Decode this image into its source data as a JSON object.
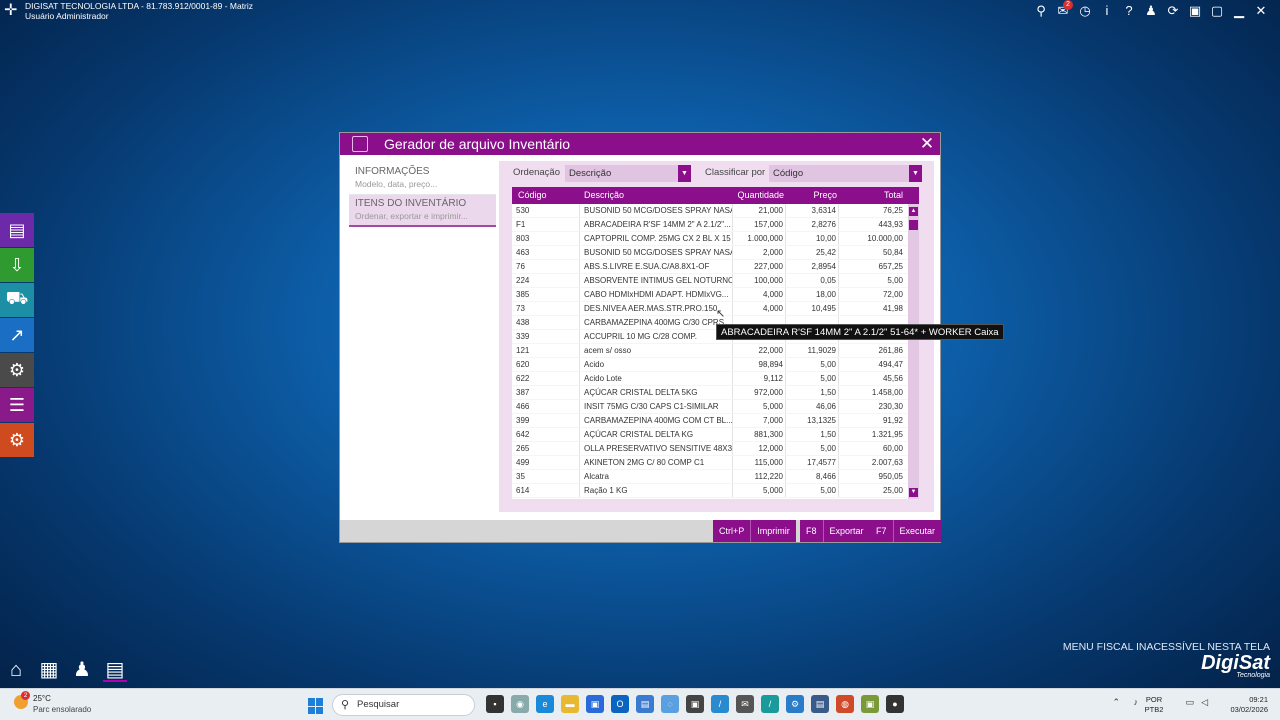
{
  "topbar": {
    "company": "DIGISAT TECNOLOGIA LTDA - 81.783.912/0001-89 - Matriz",
    "user": "Usuário Administrador",
    "notification_count": "2",
    "icons": [
      "search-icon",
      "bell-icon",
      "clock-icon",
      "info-icon",
      "help-icon",
      "users-icon",
      "sync-icon",
      "lock-icon",
      "lock-icon",
      "minimize-icon",
      "close-icon"
    ]
  },
  "sidebar": {
    "items": [
      {
        "icon": "document-icon",
        "color": "#6d2aa8"
      },
      {
        "icon": "download-cart-icon",
        "color": "#2f9a2f"
      },
      {
        "icon": "cart-icon",
        "color": "#1c8fa5"
      },
      {
        "icon": "chart-icon",
        "color": "#1a6fc4"
      },
      {
        "icon": "settings-icon",
        "color": "#4a4a4a"
      },
      {
        "icon": "report-icon",
        "color": "#8a1a8a"
      },
      {
        "icon": "doc-settings-icon",
        "color": "#d04a1f"
      }
    ]
  },
  "dialog": {
    "title": "Gerador de arquivo Inventário",
    "nav": [
      {
        "title": "INFORMAÇÕES",
        "subtitle": "Modelo, data, preço..."
      },
      {
        "title": "ITENS DO INVENTÁRIO",
        "subtitle": "Ordenar, exportar e imprimir..."
      }
    ],
    "ordenacao_label": "Ordenação",
    "ordenacao_value": "Descrição",
    "classificar_label": "Classificar por",
    "classificar_value": "Código",
    "columns": [
      "Código",
      "Descrição",
      "Quantidade",
      "Preço",
      "Total"
    ],
    "rows": [
      [
        "530",
        "BUSONID 50 MCG/DOSES SPRAY NASA...",
        "21,000",
        "3,6314",
        "76,25"
      ],
      [
        "F1",
        "ABRACADEIRA R'SF 14MM 2\" A 2.1/2\"...",
        "157,000",
        "2,8276",
        "443,93"
      ],
      [
        "803",
        "CAPTOPRIL COMP. 25MG CX 2 BL X 15",
        "1.000,000",
        "10,00",
        "10.000,00"
      ],
      [
        "463",
        "BUSONID 50 MCG/DOSES SPRAY NASA...",
        "2,000",
        "25,42",
        "50,84"
      ],
      [
        "76",
        "ABS.S.LIVRE E.SUA.C/A8.8X1-OF",
        "227,000",
        "2,8954",
        "657,25"
      ],
      [
        "224",
        "ABSORVENTE INTIMUS GEL NOTURNO...",
        "100,000",
        "0,05",
        "5,00"
      ],
      [
        "385",
        "CABO HDMIxHDMI  ADAPT. HDMIxVG...",
        "4,000",
        "18,00",
        "72,00"
      ],
      [
        "73",
        "DES.NIVEA AER.MAS.STR.PRO.150",
        "4,000",
        "10,495",
        "41,98"
      ],
      [
        "438",
        "CARBAMAZEPINA 400MG C/30 CPRS",
        "",
        "",
        ""
      ],
      [
        "339",
        "ACCUPRIL 10 MG C/28 COMP.",
        "",
        "",
        ""
      ],
      [
        "121",
        "acem s/ osso",
        "22,000",
        "11,9029",
        "261,86"
      ],
      [
        "620",
        "Acido",
        "98,894",
        "5,00",
        "494,47"
      ],
      [
        "622",
        "Acido Lote",
        "9,112",
        "5,00",
        "45,56"
      ],
      [
        "387",
        "AÇÚCAR CRISTAL DELTA 5KG",
        "972,000",
        "1,50",
        "1.458,00"
      ],
      [
        "466",
        "INSIT 75MG C/30 CAPS C1-SIMILAR",
        "5,000",
        "46,06",
        "230,30"
      ],
      [
        "399",
        "CARBAMAZEPINA 400MG COM CT BL...",
        "7,000",
        "13,1325",
        "91,92"
      ],
      [
        "642",
        "AÇÚCAR CRISTAL DELTA KG",
        "881,300",
        "1,50",
        "1.321,95"
      ],
      [
        "265",
        "OLLA PRESERVATIVO SENSITIVE 48X3U...",
        "12,000",
        "5,00",
        "60,00"
      ],
      [
        "499",
        "AKINETON 2MG C/ 80 COMP C1",
        "115,000",
        "17,4577",
        "2.007,63"
      ],
      [
        "35",
        "Alcatra",
        "112,220",
        "8,466",
        "950,05"
      ],
      [
        "614",
        "Ração 1 KG",
        "5,000",
        "5,00",
        "25,00"
      ]
    ],
    "tooltip": "ABRACADEIRA R'SF 14MM 2\" A 2.1/2\" 51-64* + WORKER Caixa",
    "buttons": [
      {
        "key": "Ctrl+P",
        "label": "Imprimir"
      },
      {
        "key": "F8",
        "label": "Exportar"
      },
      {
        "key": "F7",
        "label": "Executar"
      }
    ]
  },
  "fiscal_notice": "MENU FISCAL INACESSÍVEL NESTA TELA",
  "brand": {
    "name": "DigiSat",
    "sub": "Tecnologia"
  },
  "taskbar": {
    "weather_temp": "25°C",
    "weather_desc": "Parc ensolarado",
    "weather_badge": "2",
    "search_placeholder": "Pesquisar",
    "lang_1": "POR",
    "lang_2": "PTB2",
    "time": "09:21",
    "date": "03/02/2026"
  }
}
